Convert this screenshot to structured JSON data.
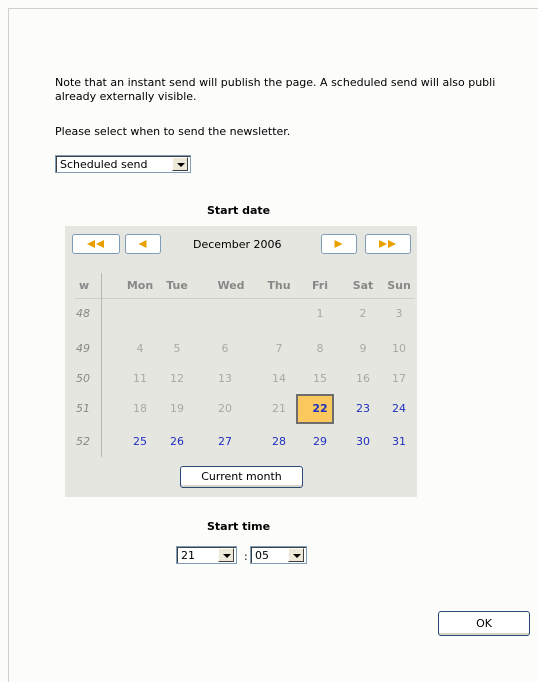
{
  "dialog": {
    "note_line1": "Note that an instant send will publish the page. A scheduled send will also publi",
    "note_line2": "already externally visible.",
    "select_prompt": "Please select when to send the newsletter.",
    "send_mode": "Scheduled send",
    "ok_label": "OK"
  },
  "calendar": {
    "title": "Start date",
    "month_label": "December 2006",
    "week_header": "w",
    "day_headers": [
      "Mon",
      "Tue",
      "Wed",
      "Thu",
      "Fri",
      "Sat",
      "Sun"
    ],
    "weeks": [
      {
        "week": "48",
        "days": [
          "",
          "",
          "",
          "",
          "1",
          "2",
          "3"
        ]
      },
      {
        "week": "49",
        "days": [
          "4",
          "5",
          "6",
          "7",
          "8",
          "9",
          "10"
        ]
      },
      {
        "week": "50",
        "days": [
          "11",
          "12",
          "13",
          "14",
          "15",
          "16",
          "17"
        ]
      },
      {
        "week": "51",
        "days": [
          "18",
          "19",
          "20",
          "21",
          "22",
          "23",
          "24"
        ]
      },
      {
        "week": "52",
        "days": [
          "25",
          "26",
          "27",
          "28",
          "29",
          "30",
          "31"
        ]
      }
    ],
    "today": "22",
    "current_month_label": "Current month",
    "colors": {
      "background": "#e6e6e0",
      "highlight": "#fbc85d",
      "active_day": "#2030c0",
      "arrow": "#e8a000"
    }
  },
  "time": {
    "title": "Start time",
    "hour": "21",
    "minute": "05",
    "separator": ":"
  }
}
